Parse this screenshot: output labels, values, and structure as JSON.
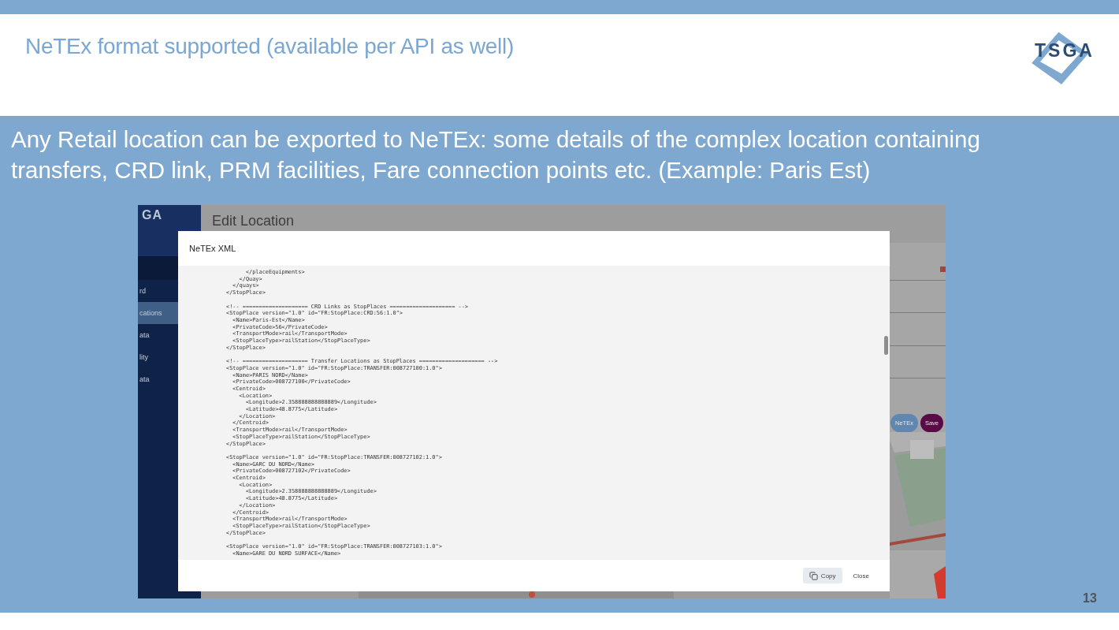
{
  "slide": {
    "title": "NeTEx format supported (available per API as well)",
    "logo": "TSGA",
    "description": "Any Retail location can be exported to NeTEx: some details of the complex location containing transfers, CRD link, PRM facilities, Fare connection points etc. (Example: Paris Est)",
    "page_number": "13"
  },
  "app": {
    "logo": "GA",
    "page_title": "Edit Location",
    "nav_items": [
      {
        "label": "rd",
        "selected": false
      },
      {
        "label": "cations",
        "selected": true
      },
      {
        "label": "ata",
        "selected": false
      },
      {
        "label": "lity",
        "selected": false
      },
      {
        "label": "ata",
        "selected": false
      }
    ],
    "buttons": [
      {
        "label": "NeTEx",
        "kind": "secondary"
      },
      {
        "label": "Save",
        "kind": "primary"
      }
    ]
  },
  "dialog": {
    "title": "NeTEx XML",
    "code_blocks": [
      [
        "      </placeEquipments>",
        "    </Quay>",
        "  </quays>",
        "</StopPlace>"
      ],
      [
        "<!-- ==================== CRD Links as StopPlaces ==================== -->",
        "<StopPlace version=\"1.0\" id=\"FR:StopPlace:CRD:56:1.0\">",
        "  <Name>Paris-Est</Name>",
        "  <PrivateCode>56</PrivateCode>",
        "  <TransportMode>rail</TransportMode>",
        "  <StopPlaceType>railStation</StopPlaceType>",
        "</StopPlace>"
      ],
      [
        "<!-- ==================== Transfer Locations as StopPlaces ==================== -->",
        "<StopPlace version=\"1.0\" id=\"FR:StopPlace:TRANSFER:008727100:1.0\">",
        "  <Name>PARIS NORD</Name>",
        "  <PrivateCode>008727100</PrivateCode>",
        "  <Centroid>",
        "    <Location>",
        "      <Longitude>2.358888888888889</Longitude>",
        "      <Latitude>48.8775</Latitude>",
        "    </Location>",
        "  </Centroid>",
        "  <TransportMode>rail</TransportMode>",
        "  <StopPlaceType>railStation</StopPlaceType>",
        "</StopPlace>"
      ],
      [
        "<StopPlace version=\"1.0\" id=\"FR:StopPlace:TRANSFER:008727102:1.0\">",
        "  <Name>GARC DU NORD</Name>",
        "  <PrivateCode>008727102</PrivateCode>",
        "  <Centroid>",
        "    <Location>",
        "      <Longitude>2.358888888888889</Longitude>",
        "      <Latitude>48.8775</Latitude>",
        "    </Location>",
        "  </Centroid>",
        "  <TransportMode>rail</TransportMode>",
        "  <StopPlaceType>railStation</StopPlaceType>",
        "</StopPlace>"
      ],
      [
        "<StopPlace version=\"1.0\" id=\"FR:StopPlace:TRANSFER:008727103:1.0\">",
        "  <Name>GARE DU NORD SURFACE</Name>"
      ]
    ],
    "actions": [
      {
        "label": "Copy",
        "kind": "copy"
      },
      {
        "label": "Close",
        "kind": "text"
      }
    ]
  }
}
